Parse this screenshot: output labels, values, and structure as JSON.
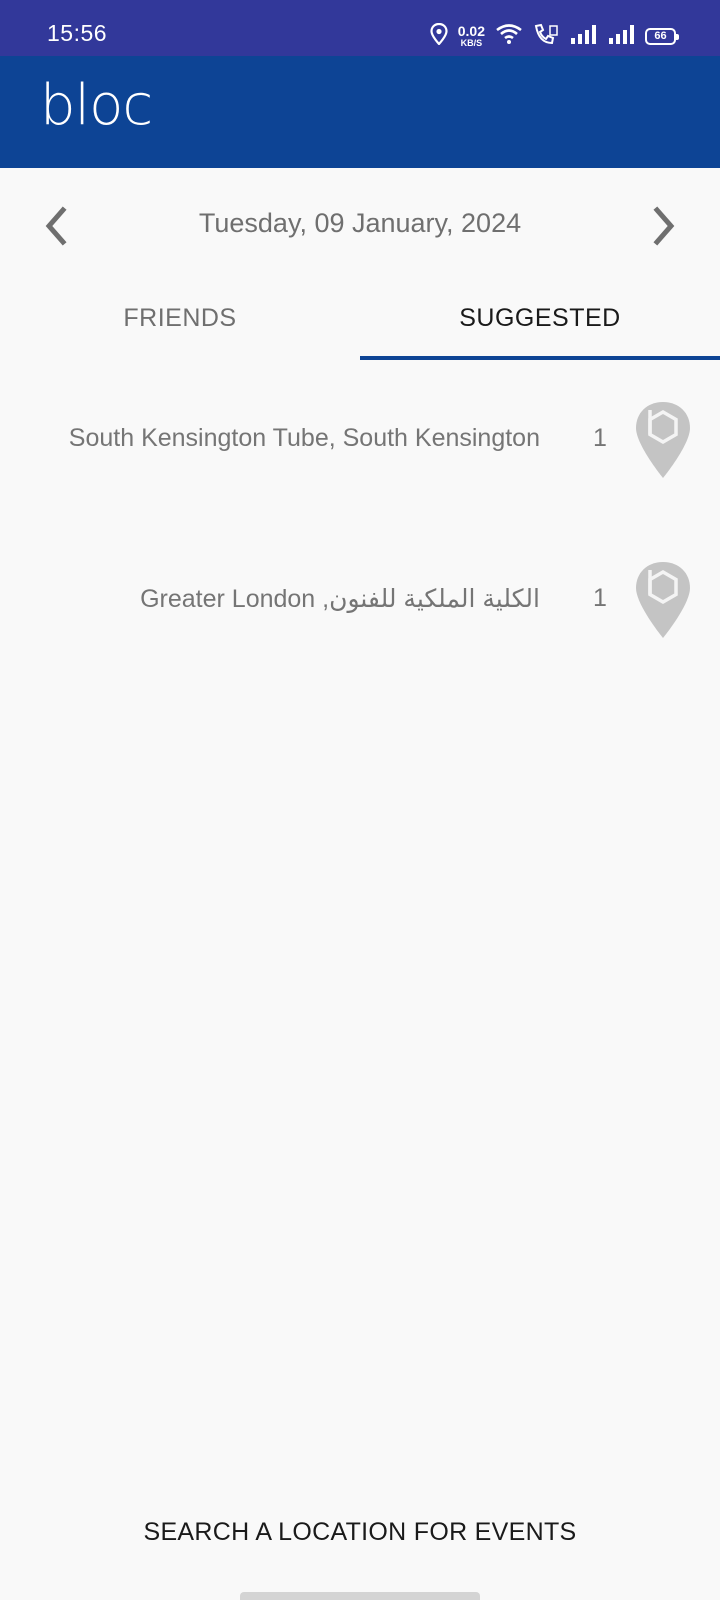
{
  "status_bar": {
    "time": "15:56",
    "net_speed_value": "0.02",
    "net_speed_unit": "KB/S",
    "battery": "66",
    "icons": [
      "location-icon",
      "wifi-icon",
      "call-icon",
      "signal-icon",
      "signal-icon",
      "battery-icon"
    ]
  },
  "app_bar": {
    "logo": "bloc",
    "color": "#0d4495"
  },
  "date_nav": {
    "date": "Tuesday, 09 January, 2024",
    "prev_icon": "chevron-left-icon",
    "next_icon": "chevron-right-icon"
  },
  "tabs": [
    {
      "label": "FRIENDS",
      "selected": false
    },
    {
      "label": "SUGGESTED",
      "selected": true
    }
  ],
  "locations": [
    {
      "name": "South Kensington Tube, South Kensington",
      "count": "1",
      "icon": "map-pin-icon"
    },
    {
      "name": "Greater London ,الكلية الملكية للفنون",
      "count": "1",
      "icon": "map-pin-icon"
    }
  ],
  "footer": {
    "search_label": "SEARCH A LOCATION FOR EVENTS"
  },
  "colors": {
    "status_bar": "#32389a",
    "accent": "#0d4495",
    "background": "#f9f9f9",
    "pin": "#c4c4c4"
  }
}
